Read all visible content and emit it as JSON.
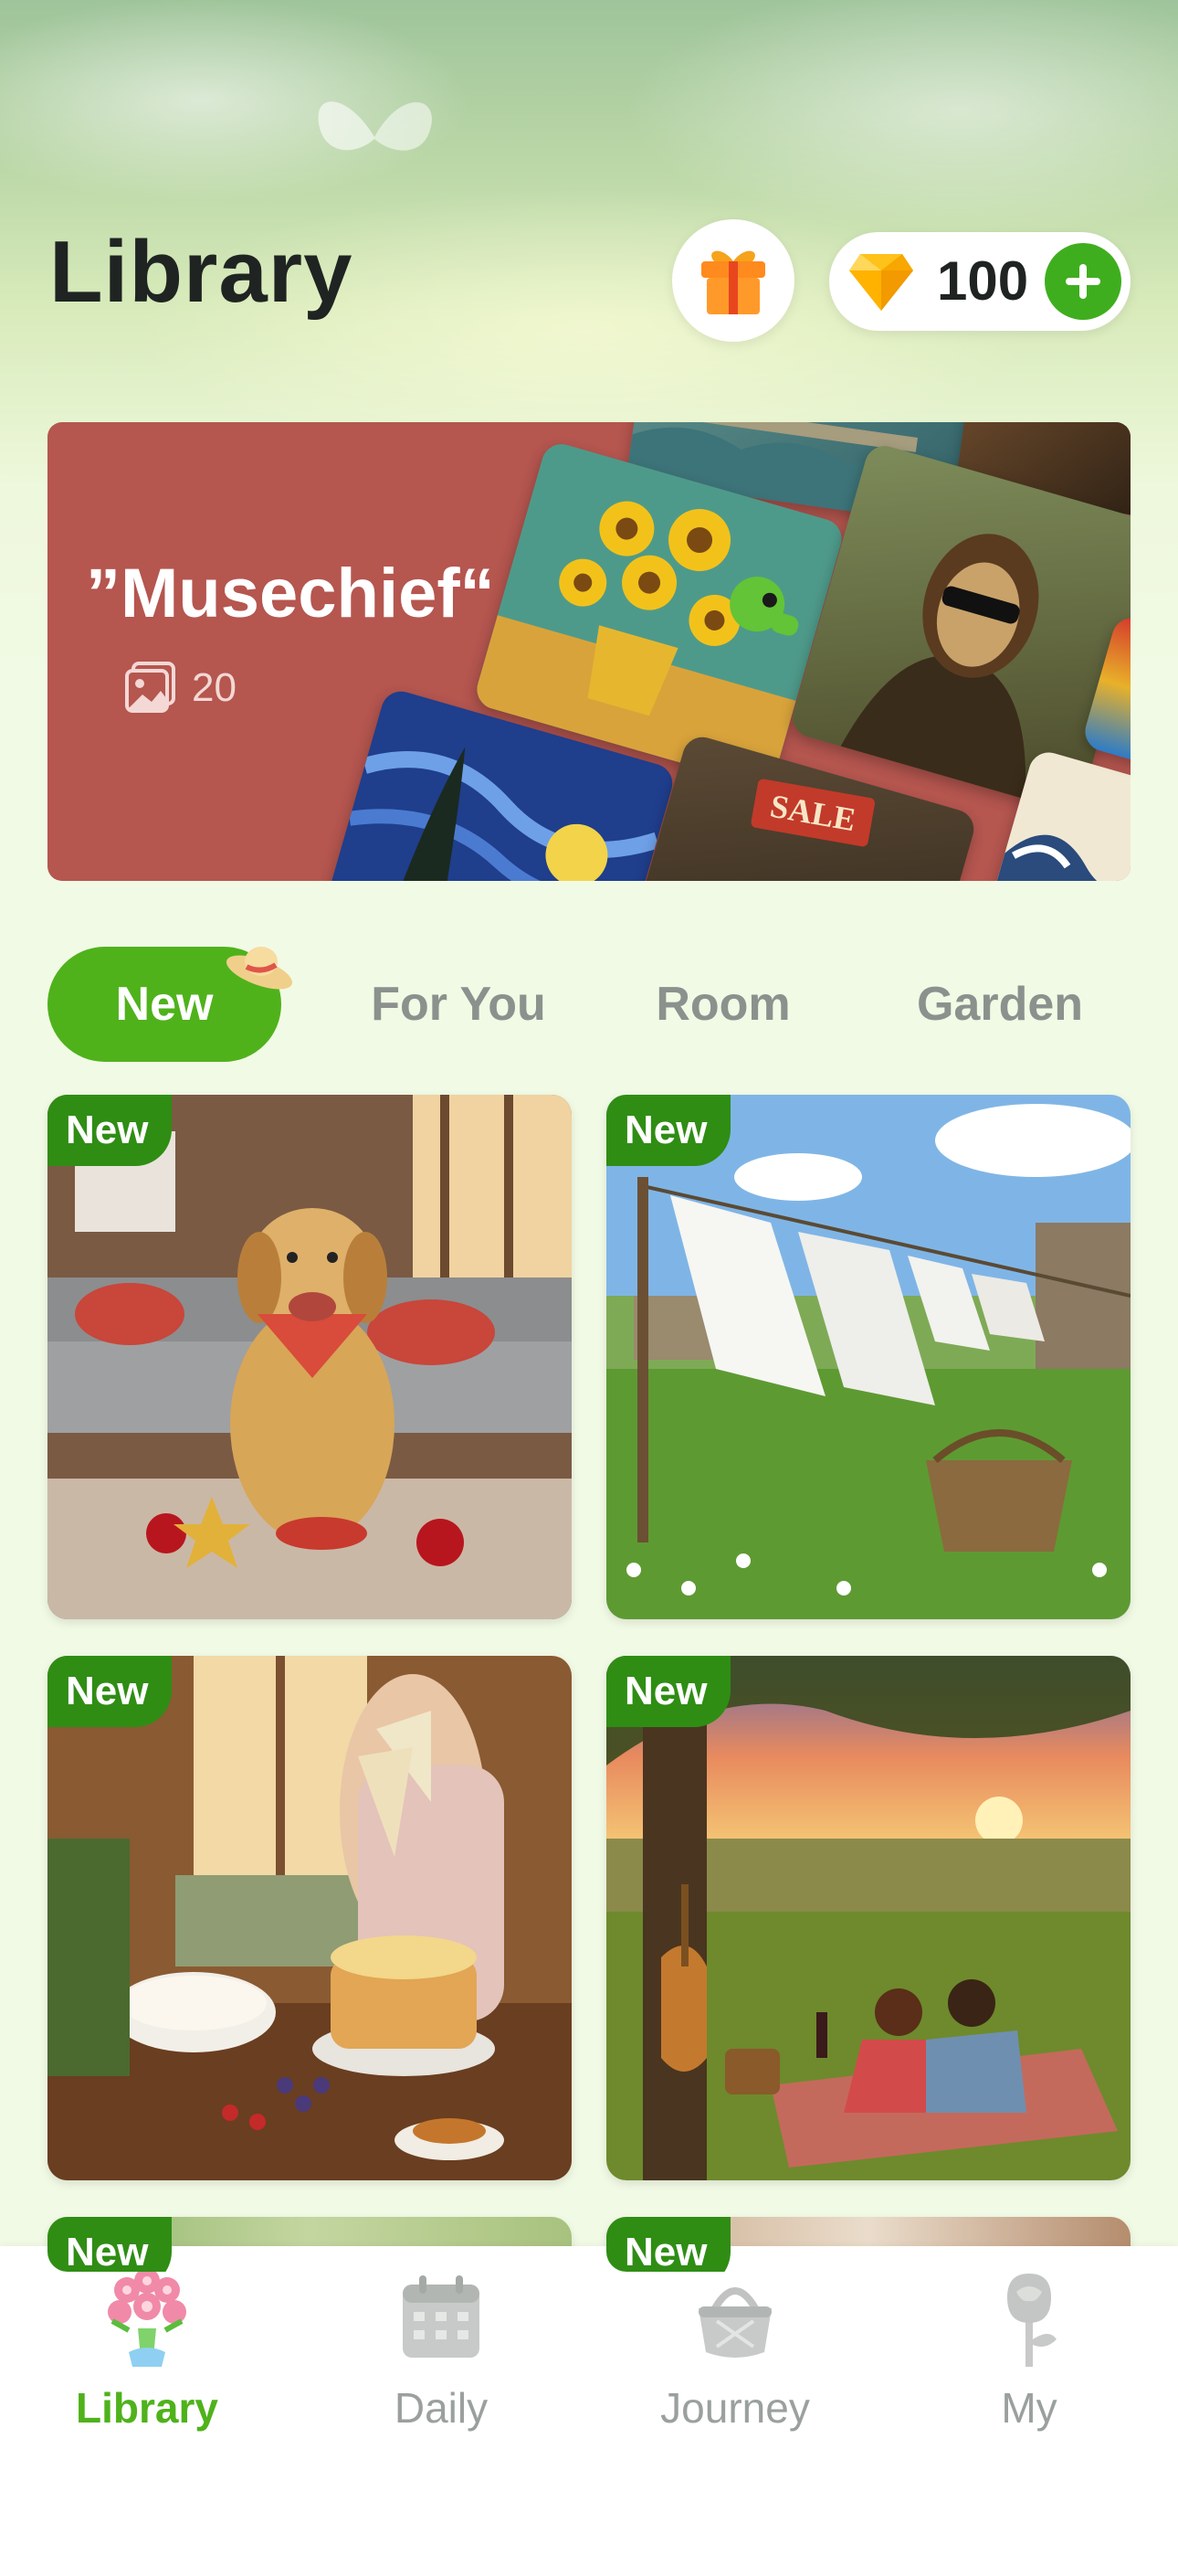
{
  "header": {
    "title": "Library",
    "gems": "100"
  },
  "banner": {
    "title": "”Musechief“",
    "count": "20",
    "sale_label": "SALE",
    "color": "#b5564f"
  },
  "tabs": [
    {
      "label": "New",
      "active": true
    },
    {
      "label": "For You",
      "active": false
    },
    {
      "label": "Room",
      "active": false
    },
    {
      "label": "Garden",
      "active": false
    }
  ],
  "cards": [
    {
      "badge": "New",
      "subject": "golden retriever in living room"
    },
    {
      "badge": "New",
      "subject": "laundry on clothesline in meadow"
    },
    {
      "badge": "New",
      "subject": "woman decorating cake in kitchen"
    },
    {
      "badge": "New",
      "subject": "couple picnic at sunset"
    },
    {
      "badge": "New",
      "subject": "garden scene"
    },
    {
      "badge": "New",
      "subject": "interior scene"
    }
  ],
  "nav": [
    {
      "label": "Library",
      "icon": "flower-bouquet-icon",
      "active": true
    },
    {
      "label": "Daily",
      "icon": "calendar-icon",
      "active": false
    },
    {
      "label": "Journey",
      "icon": "basket-icon",
      "active": false
    },
    {
      "label": "My",
      "icon": "rose-icon",
      "active": false
    }
  ],
  "colors": {
    "accent": "#4fb21b",
    "badge": "#2f8d14",
    "inactive_text": "#8b918d"
  }
}
